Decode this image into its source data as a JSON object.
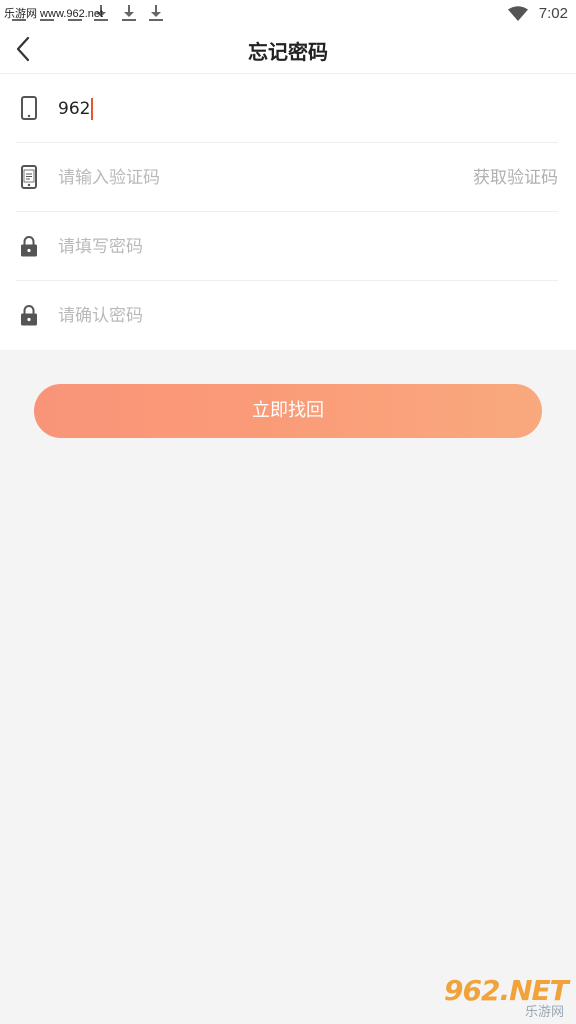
{
  "status_bar": {
    "watermark": "乐游网 www.962.net",
    "time": "7:02",
    "icons": [
      "download-icon",
      "download-icon",
      "download-icon",
      "download-icon",
      "download-icon",
      "download-icon",
      "wifi-icon"
    ]
  },
  "header": {
    "title": "忘记密码",
    "back_icon": "chevron-left-icon"
  },
  "form": {
    "phone": {
      "icon": "phone-icon",
      "value": "962"
    },
    "code": {
      "icon": "phone-code-icon",
      "placeholder": "请输入验证码",
      "button_label": "获取验证码"
    },
    "password": {
      "icon": "lock-icon",
      "placeholder": "请填写密码"
    },
    "confirm": {
      "icon": "lock-icon",
      "placeholder": "请确认密码"
    }
  },
  "submit_label": "立即找回",
  "corner_logo": {
    "big": "962.NET",
    "small": "乐游网"
  },
  "colors": {
    "accent_start": "#f99479",
    "accent_end": "#f9a97e",
    "caret": "#e8542b",
    "page_bg": "#f4f4f4"
  }
}
